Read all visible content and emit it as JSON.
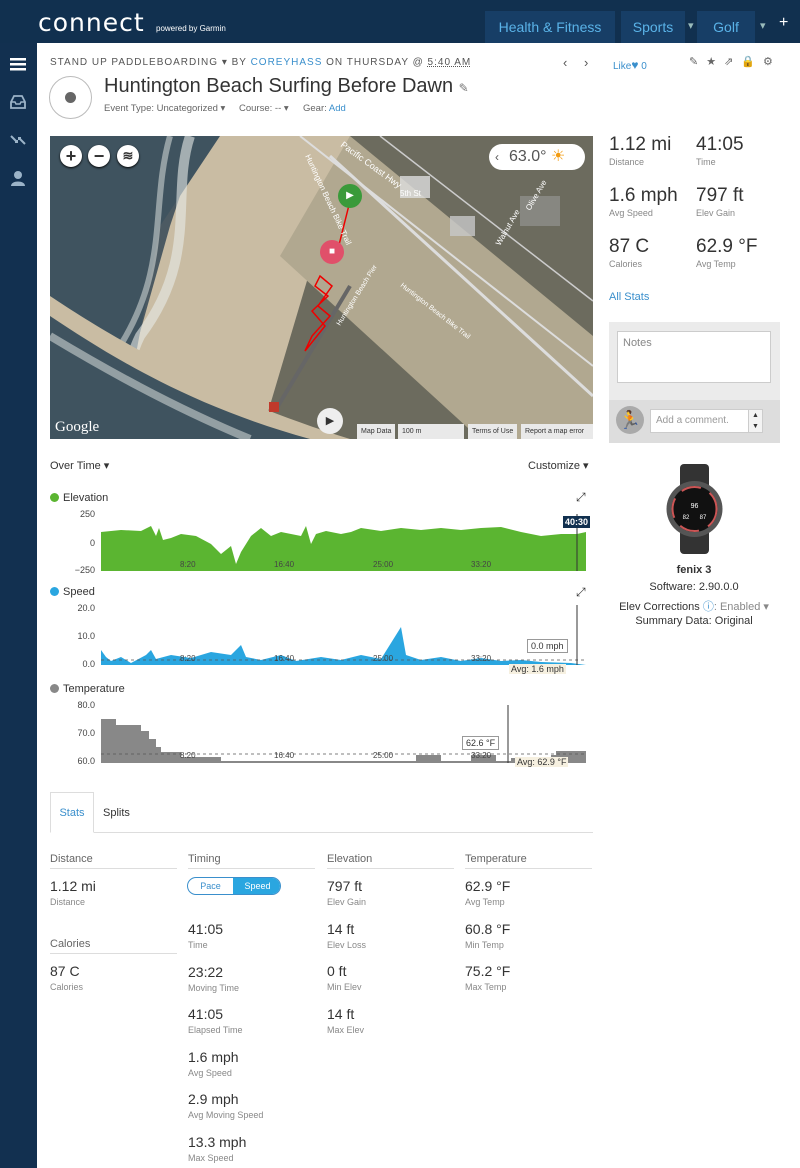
{
  "header": {
    "logo": "connect",
    "logo_sub": "powered by Garmin",
    "nav": [
      "Health & Fitness",
      "Sports",
      "Golf"
    ],
    "plus": "+"
  },
  "breadcrumb": {
    "activity_type": "STAND UP PADDLEBOARDING",
    "by": "BY",
    "user": "COREYHASS",
    "on": "ON THURSDAY @",
    "time": "5:40 AM"
  },
  "like": {
    "label": "Like",
    "count": "0"
  },
  "activity": {
    "title": "Huntington Beach Surfing Before Dawn",
    "event_type": "Event Type: Uncategorized",
    "course": "Course: --",
    "gear": "Gear:",
    "gear_add": "Add"
  },
  "map": {
    "temp": "63.0°",
    "google": "Google",
    "footer": [
      "Map Data",
      "100 m",
      "Terms of Use",
      "Report a map error"
    ]
  },
  "summary": [
    {
      "value": "1.12 mi",
      "label": "Distance"
    },
    {
      "value": "41:05",
      "label": "Time"
    },
    {
      "value": "1.6 mph",
      "label": "Avg Speed"
    },
    {
      "value": "797 ft",
      "label": "Elev Gain"
    },
    {
      "value": "87 C",
      "label": "Calories"
    },
    {
      "value": "62.9 °F",
      "label": "Avg Temp"
    }
  ],
  "all_stats": "All Stats",
  "notes": {
    "placeholder": "Notes",
    "comment": "Add a comment."
  },
  "device": {
    "name": "fenix 3",
    "software": "Software: 2.90.0.0",
    "elev_corr": "Elev Corrections",
    "elev_corr_val": "Enabled",
    "summary_data": "Summary Data: Original",
    "watch_face": [
      "96",
      "82",
      "87"
    ]
  },
  "charts": {
    "over_time": "Over Time",
    "customize": "Customize",
    "elevation": {
      "label": "Elevation",
      "y": [
        "250",
        "0",
        "−250"
      ],
      "x": [
        "8:20",
        "16:40",
        "25:00",
        "33:20"
      ],
      "cursor": "40:30",
      "color": "#5bb531"
    },
    "speed": {
      "label": "Speed",
      "y": [
        "20.0",
        "10.0",
        "0.0"
      ],
      "x": [
        "8:20",
        "16:40",
        "25:00",
        "33:20"
      ],
      "tooltip": "0.0 mph",
      "avg": "Avg: 1.6 mph",
      "color": "#2aa6e0"
    },
    "temperature": {
      "label": "Temperature",
      "y": [
        "80.0",
        "70.0",
        "60.0"
      ],
      "x": [
        "8:20",
        "16:40",
        "25:00",
        "33:20"
      ],
      "tooltip": "62.6 °F",
      "avg": "Avg: 62.9 °F",
      "color": "#888888"
    }
  },
  "tabs": [
    "Stats",
    "Splits"
  ],
  "stats": {
    "distance": {
      "head": "Distance",
      "items": [
        {
          "v": "1.12 mi",
          "l": "Distance"
        }
      ]
    },
    "calories": {
      "head": "Calories",
      "items": [
        {
          "v": "87 C",
          "l": "Calories"
        }
      ]
    },
    "timing": {
      "head": "Timing",
      "toggle": [
        "Pace",
        "Speed"
      ],
      "items": [
        {
          "v": "41:05",
          "l": "Time"
        },
        {
          "v": "23:22",
          "l": "Moving Time"
        },
        {
          "v": "41:05",
          "l": "Elapsed Time"
        },
        {
          "v": "1.6 mph",
          "l": "Avg Speed"
        },
        {
          "v": "2.9 mph",
          "l": "Avg Moving Speed"
        },
        {
          "v": "13.3 mph",
          "l": "Max Speed"
        }
      ]
    },
    "elevation": {
      "head": "Elevation",
      "items": [
        {
          "v": "797 ft",
          "l": "Elev Gain"
        },
        {
          "v": "14 ft",
          "l": "Elev Loss"
        },
        {
          "v": "0 ft",
          "l": "Min Elev"
        },
        {
          "v": "14 ft",
          "l": "Max Elev"
        }
      ]
    },
    "temperature": {
      "head": "Temperature",
      "items": [
        {
          "v": "62.9 °F",
          "l": "Avg Temp"
        },
        {
          "v": "60.8 °F",
          "l": "Min Temp"
        },
        {
          "v": "75.2 °F",
          "l": "Max Temp"
        }
      ]
    }
  }
}
